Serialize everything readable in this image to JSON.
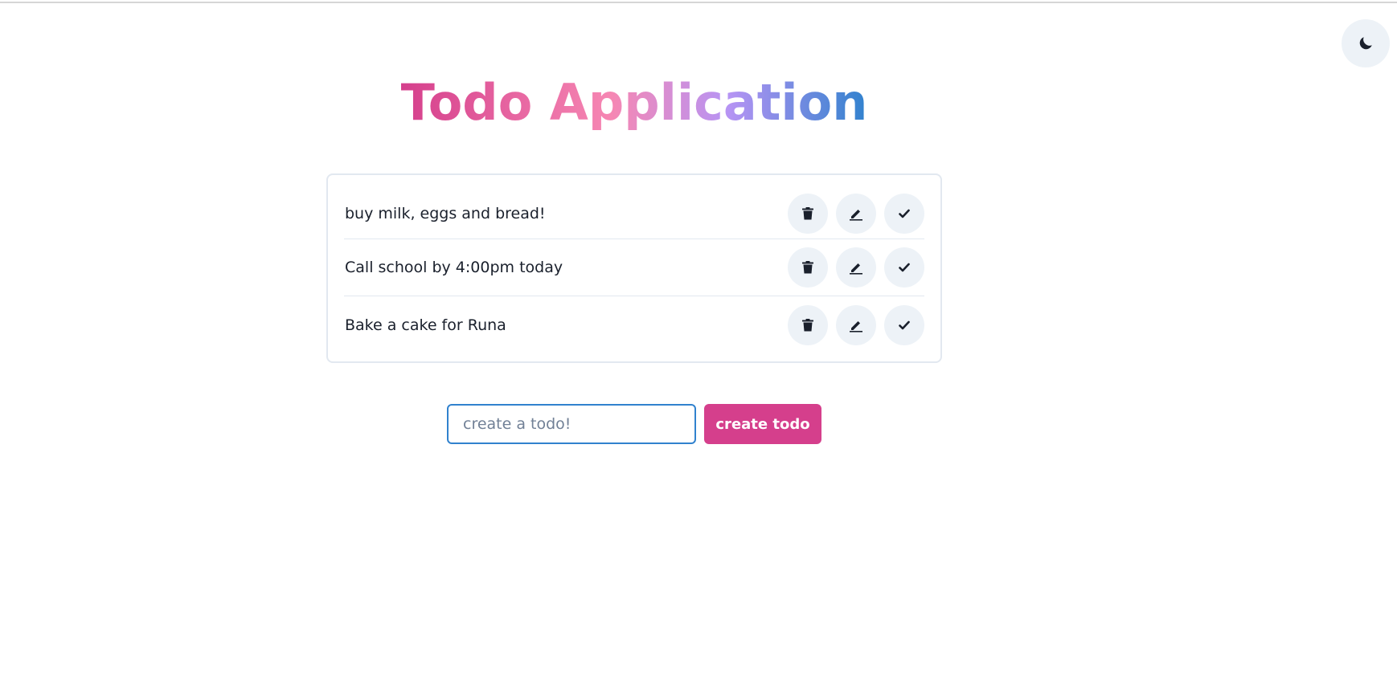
{
  "header": {
    "title": "Todo Application",
    "theme_toggle_icon": "moon-icon"
  },
  "todos": [
    {
      "text": "buy milk, eggs and bread!"
    },
    {
      "text": "Call school by 4:00pm today"
    },
    {
      "text": "Bake a cake for Runa"
    }
  ],
  "todo_actions": {
    "delete_icon": "trash-icon",
    "edit_icon": "pencil-icon",
    "complete_icon": "check-icon"
  },
  "form": {
    "input_value": "",
    "input_placeholder": "create a todo!",
    "submit_label": "create todo"
  },
  "colors": {
    "accent": "#d53f8c",
    "focus": "#3182ce",
    "button_bg": "#edf2f7",
    "title_gradient": [
      "#d53f8c",
      "#f687b3",
      "#b794f4",
      "#3182ce"
    ]
  }
}
